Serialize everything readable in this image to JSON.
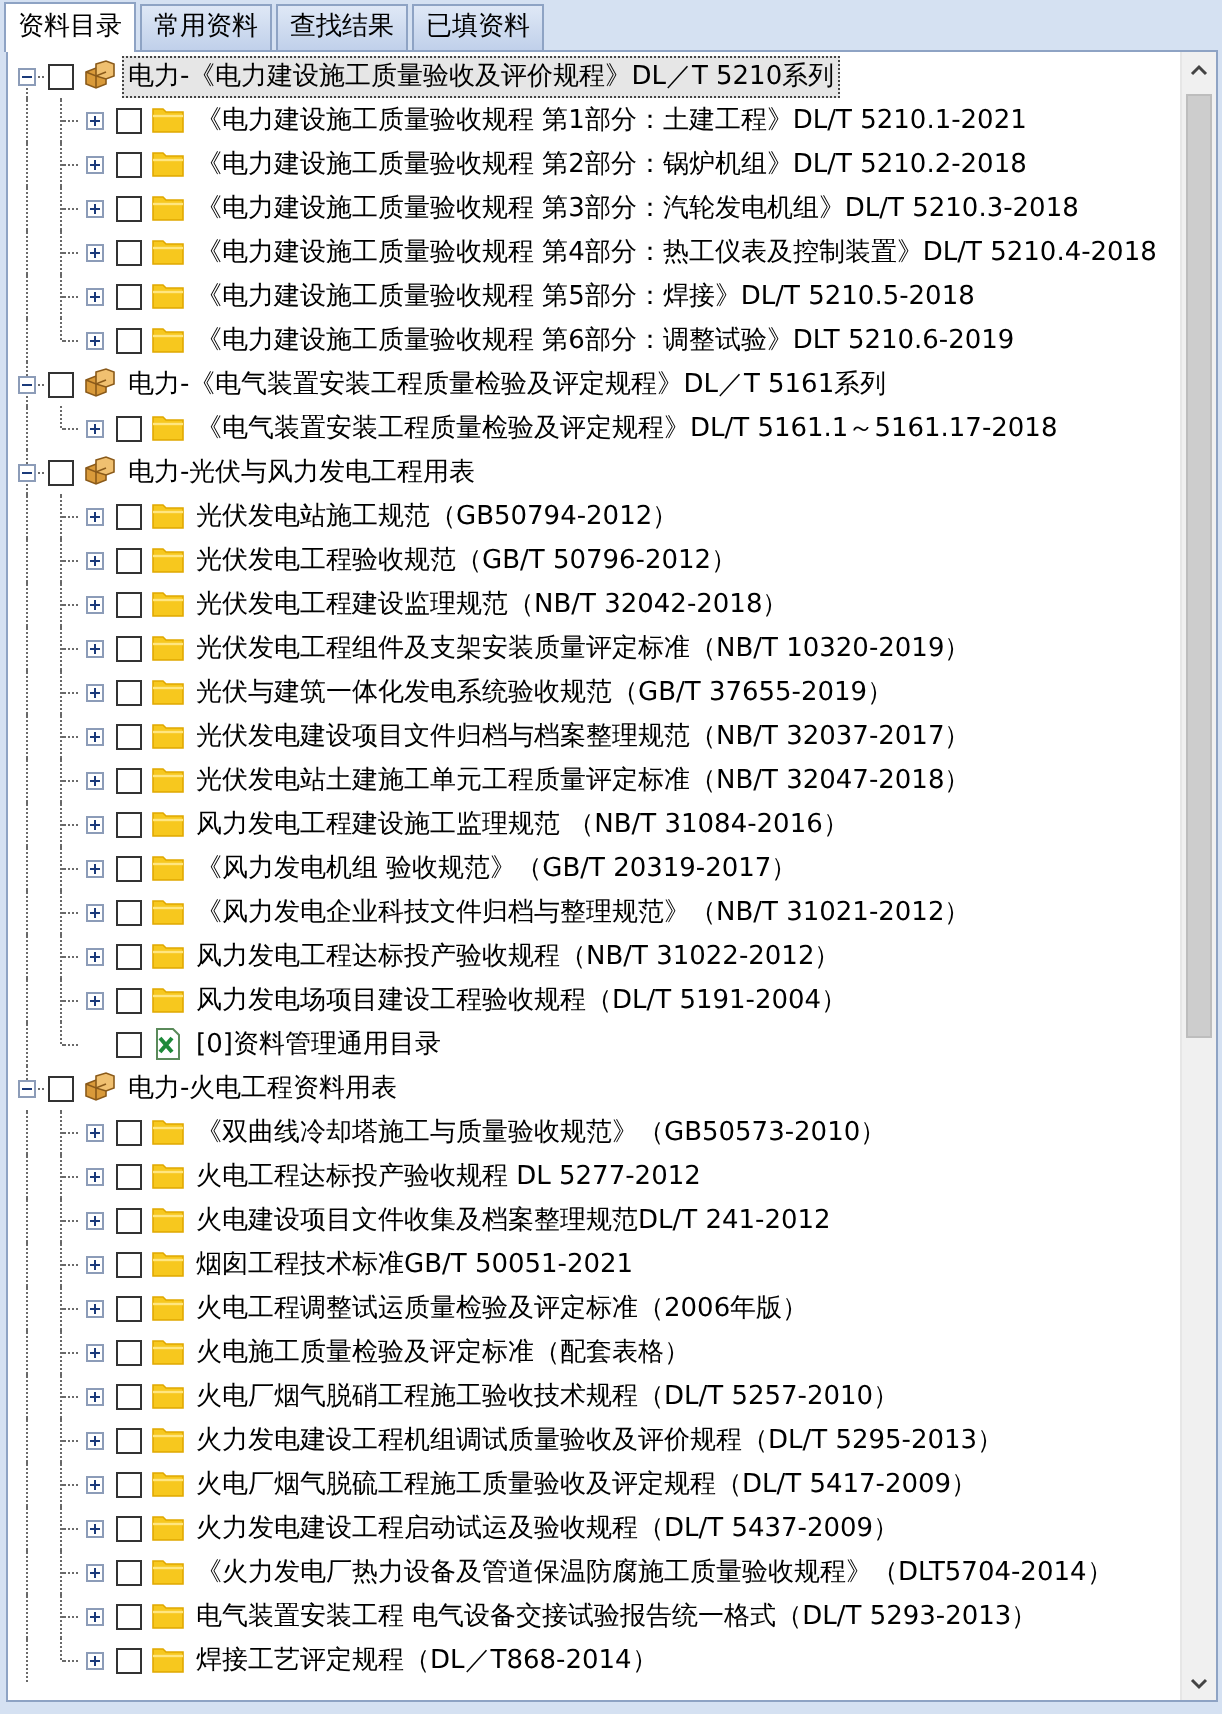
{
  "tabs": [
    {
      "label": "资料目录",
      "selected": true
    },
    {
      "label": "常用资料",
      "selected": false
    },
    {
      "label": "查找结果",
      "selected": false
    },
    {
      "label": "已填资料",
      "selected": false
    }
  ],
  "tree": [
    {
      "kind": "package",
      "label": "电力-《电力建设施工质量验收及评价规程》DL／T 5210系列",
      "expanded": true,
      "checked": false,
      "selected": true,
      "children": [
        {
          "kind": "folder",
          "label": "《电力建设施工质量验收规程 第1部分：土建工程》DL/T 5210.1-2021",
          "expanded": false,
          "checked": false,
          "selected": false
        },
        {
          "kind": "folder",
          "label": "《电力建设施工质量验收规程 第2部分：锅炉机组》DL/T 5210.2-2018",
          "expanded": false,
          "checked": false,
          "selected": false
        },
        {
          "kind": "folder",
          "label": "《电力建设施工质量验收规程 第3部分：汽轮发电机组》DL/T 5210.3-2018",
          "expanded": false,
          "checked": false,
          "selected": false
        },
        {
          "kind": "folder",
          "label": "《电力建设施工质量验收规程 第4部分：热工仪表及控制装置》DL/T 5210.4-2018",
          "expanded": false,
          "checked": false,
          "selected": false
        },
        {
          "kind": "folder",
          "label": "《电力建设施工质量验收规程 第5部分：焊接》DL/T 5210.5-2018",
          "expanded": false,
          "checked": false,
          "selected": false
        },
        {
          "kind": "folder",
          "label": "《电力建设施工质量验收规程 第6部分：调整试验》DLT 5210.6-2019",
          "expanded": false,
          "checked": false,
          "selected": false
        }
      ]
    },
    {
      "kind": "package",
      "label": "电力-《电气装置安装工程质量检验及评定规程》DL／T 5161系列",
      "expanded": true,
      "checked": false,
      "selected": false,
      "children": [
        {
          "kind": "folder",
          "label": "《电气装置安装工程质量检验及评定规程》DL/T 5161.1～5161.17-2018",
          "expanded": false,
          "checked": false,
          "selected": false
        }
      ]
    },
    {
      "kind": "package",
      "label": "电力-光伏与风力发电工程用表",
      "expanded": true,
      "checked": false,
      "selected": false,
      "children": [
        {
          "kind": "folder",
          "label": "光伏发电站施工规范（GB50794-2012）",
          "expanded": false,
          "checked": false,
          "selected": false
        },
        {
          "kind": "folder",
          "label": "光伏发电工程验收规范（GB/T 50796-2012）",
          "expanded": false,
          "checked": false,
          "selected": false
        },
        {
          "kind": "folder",
          "label": "光伏发电工程建设监理规范（NB/T 32042-2018）",
          "expanded": false,
          "checked": false,
          "selected": false
        },
        {
          "kind": "folder",
          "label": "光伏发电工程组件及支架安装质量评定标准（NB/T 10320-2019）",
          "expanded": false,
          "checked": false,
          "selected": false
        },
        {
          "kind": "folder",
          "label": "光伏与建筑一体化发电系统验收规范（GB/T 37655-2019）",
          "expanded": false,
          "checked": false,
          "selected": false
        },
        {
          "kind": "folder",
          "label": "光伏发电建设项目文件归档与档案整理规范（NB/T 32037-2017）",
          "expanded": false,
          "checked": false,
          "selected": false
        },
        {
          "kind": "folder",
          "label": "光伏发电站土建施工单元工程质量评定标准（NB/T 32047-2018）",
          "expanded": false,
          "checked": false,
          "selected": false
        },
        {
          "kind": "folder",
          "label": "风力发电工程建设施工监理规范 （NB/T 31084-2016）",
          "expanded": false,
          "checked": false,
          "selected": false
        },
        {
          "kind": "folder",
          "label": "《风力发电机组 验收规范》（GB/T 20319-2017）",
          "expanded": false,
          "checked": false,
          "selected": false
        },
        {
          "kind": "folder",
          "label": "《风力发电企业科技文件归档与整理规范》（NB/T 31021-2012）",
          "expanded": false,
          "checked": false,
          "selected": false
        },
        {
          "kind": "folder",
          "label": "风力发电工程达标投产验收规程（NB/T 31022-2012）",
          "expanded": false,
          "checked": false,
          "selected": false
        },
        {
          "kind": "folder",
          "label": "风力发电场项目建设工程验收规程（DL/T 5191-2004）",
          "expanded": false,
          "checked": false,
          "selected": false
        },
        {
          "kind": "sheet",
          "label": "[0]资料管理通用目录",
          "checked": false,
          "selected": false
        }
      ]
    },
    {
      "kind": "package",
      "label": "电力-火电工程资料用表",
      "expanded": true,
      "checked": false,
      "selected": false,
      "children": [
        {
          "kind": "folder",
          "label": "《双曲线冷却塔施工与质量验收规范》（GB50573-2010）",
          "expanded": false,
          "checked": false,
          "selected": false
        },
        {
          "kind": "folder",
          "label": "火电工程达标投产验收规程 DL 5277-2012",
          "expanded": false,
          "checked": false,
          "selected": false
        },
        {
          "kind": "folder",
          "label": "火电建设项目文件收集及档案整理规范DL/T 241-2012",
          "expanded": false,
          "checked": false,
          "selected": false
        },
        {
          "kind": "folder",
          "label": "烟囱工程技术标准GB/T 50051-2021",
          "expanded": false,
          "checked": false,
          "selected": false
        },
        {
          "kind": "folder",
          "label": "火电工程调整试运质量检验及评定标准（2006年版）",
          "expanded": false,
          "checked": false,
          "selected": false
        },
        {
          "kind": "folder",
          "label": "火电施工质量检验及评定标准（配套表格）",
          "expanded": false,
          "checked": false,
          "selected": false
        },
        {
          "kind": "folder",
          "label": "火电厂烟气脱硝工程施工验收技术规程（DL/T 5257-2010）",
          "expanded": false,
          "checked": false,
          "selected": false
        },
        {
          "kind": "folder",
          "label": "火力发电建设工程机组调试质量验收及评价规程（DL/T 5295-2013）",
          "expanded": false,
          "checked": false,
          "selected": false
        },
        {
          "kind": "folder",
          "label": "火电厂烟气脱硫工程施工质量验收及评定规程（DL/T 5417-2009）",
          "expanded": false,
          "checked": false,
          "selected": false
        },
        {
          "kind": "folder",
          "label": "火力发电建设工程启动试运及验收规程（DL/T 5437-2009）",
          "expanded": false,
          "checked": false,
          "selected": false
        },
        {
          "kind": "folder",
          "label": "《火力发电厂热力设备及管道保温防腐施工质量验收规程》（DLT5704-2014）",
          "expanded": false,
          "checked": false,
          "selected": false
        },
        {
          "kind": "folder",
          "label": "电气装置安装工程 电气设备交接试验报告统一格式（DL/T 5293-2013）",
          "expanded": false,
          "checked": false,
          "selected": false
        },
        {
          "kind": "folder",
          "label": "焊接工艺评定规程（DL／T868-2014）",
          "expanded": false,
          "checked": false,
          "selected": false
        }
      ]
    }
  ]
}
